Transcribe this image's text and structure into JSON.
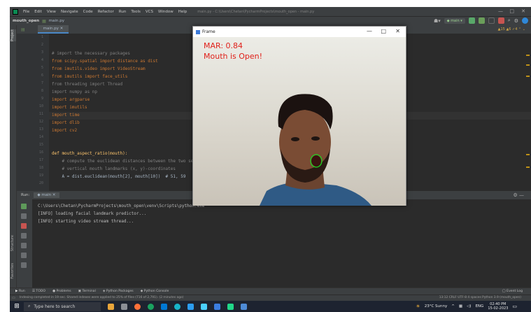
{
  "menubar": {
    "items": [
      "File",
      "Edit",
      "View",
      "Navigate",
      "Code",
      "Refactor",
      "Run",
      "Tools",
      "VCS",
      "Window",
      "Help"
    ],
    "path": "main.py - C:\\Users\\Chetan\\PycharmProjects\\mouth_open - main.py"
  },
  "navbar": {
    "project": "mouth_open",
    "file": "main.py",
    "run_config": "main"
  },
  "editor": {
    "tab_label": "main.py",
    "inspection": "▲15 ▲6 ✓4",
    "line_numbers": [
      "1",
      "2",
      "3",
      "4",
      "5",
      "6",
      "7",
      "8",
      "9",
      "10",
      "11",
      "12",
      "13",
      "14",
      "15",
      "16",
      "17",
      "18",
      "19",
      "20",
      "21",
      "22"
    ],
    "lines": [
      "",
      "# import the necessary packages",
      "from scipy.spatial import distance as dist",
      "from imutils.video import VideoStream",
      "from imutils import face_utils",
      "from threading import Thread",
      "import numpy as np",
      "import argparse",
      "import imutils",
      "import time",
      "import dlib",
      "import cv2",
      "",
      "",
      "def mouth_aspect_ratio(mouth):",
      "    # compute the euclidean distances between the two sets of",
      "    # vertical mouth landmarks (x, y)-coordinates",
      "    A = dist.euclidean(mouth[2], mouth[10])  # 51, 59"
    ]
  },
  "run": {
    "title": "Run:",
    "config": "main",
    "output": [
      "C:\\Users\\Chetan\\PycharmProjects\\mouth_open\\venv\\Scripts\\python.exe",
      "[INFO] loading facial landmark predictor...",
      "[INFO] starting video stream thread..."
    ]
  },
  "tooltabs": [
    "Run",
    "TODO",
    "Problems",
    "Terminal",
    "Python Packages",
    "Python Console"
  ],
  "event_log": "Event Log",
  "status": {
    "message": "Indexing completed in 19 sec. Shared indexes were applied to 25% of files (716 of 2,791). (2 minutes ago)",
    "right": "13:12  CRLF  UTF-8  4 spaces  Python 3.9 (mouth_open)"
  },
  "frame_window": {
    "title": "Frame",
    "mar_text": "MAR: 0.84",
    "status_text": "Mouth is Open!"
  },
  "taskbar": {
    "search_placeholder": "Type here to search",
    "weather": "23°C  Sunny",
    "lang": "ENG",
    "time": "02:40 PM",
    "date": "15-02-2023"
  },
  "colors": {
    "overlay_text": "#e0201a",
    "mouth_contour": "#1fd11f"
  }
}
